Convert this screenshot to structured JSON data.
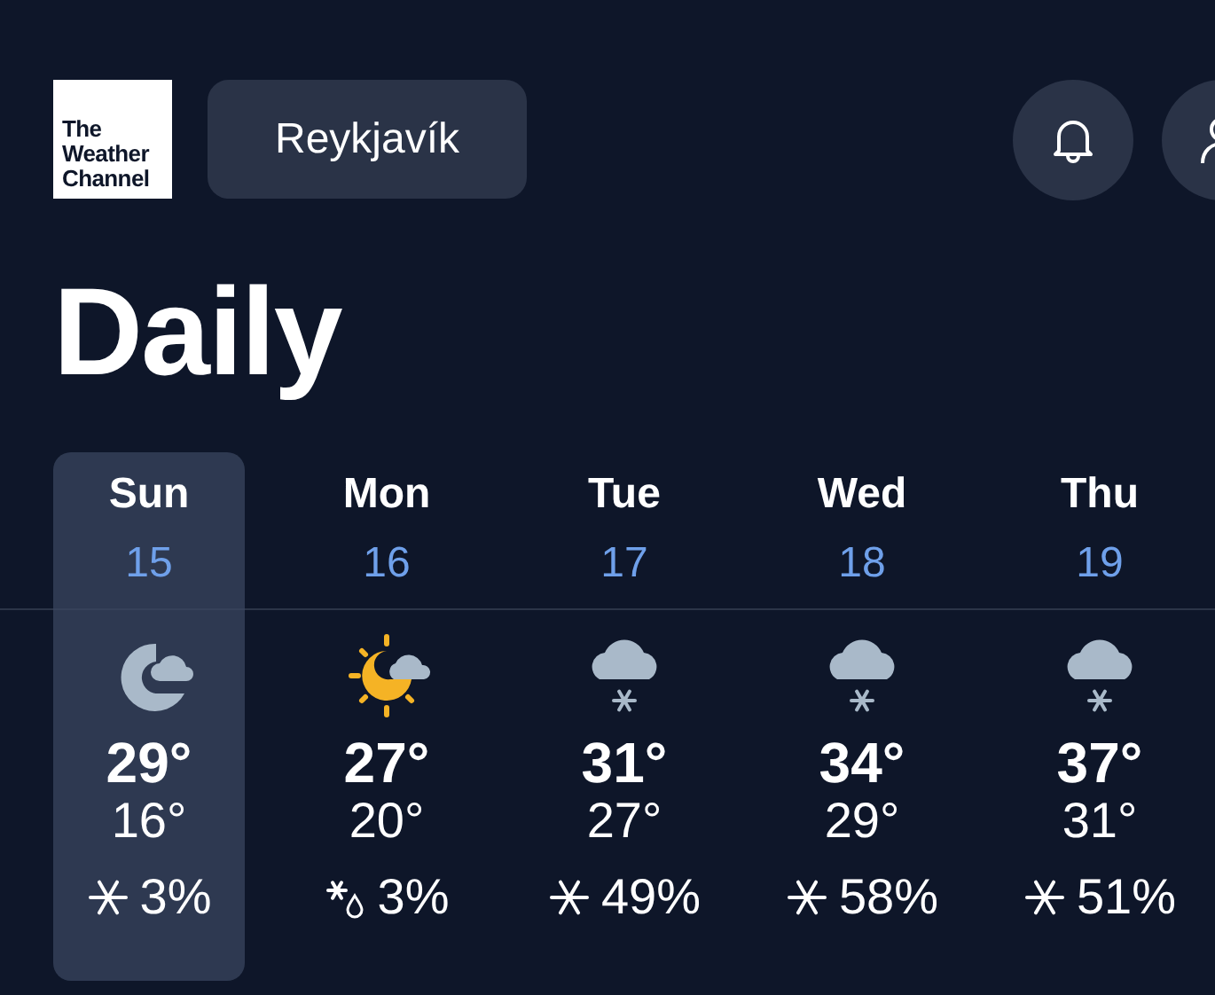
{
  "logo": {
    "lines": [
      "The",
      "Weather",
      "Channel"
    ]
  },
  "location": "Reykjavík",
  "title": "Daily",
  "days": [
    {
      "day": "Sun",
      "date": "15",
      "selected": true,
      "kind": "night-cloudy",
      "high": "29°",
      "low": "16°",
      "precip": {
        "kind": "snow",
        "text": "3%"
      }
    },
    {
      "day": "Mon",
      "date": "16",
      "selected": false,
      "kind": "partly-cloudy",
      "high": "27°",
      "low": "20°",
      "precip": {
        "kind": "mixed",
        "text": "3%"
      }
    },
    {
      "day": "Tue",
      "date": "17",
      "selected": false,
      "kind": "snow",
      "high": "31°",
      "low": "27°",
      "precip": {
        "kind": "snow",
        "text": "49%"
      }
    },
    {
      "day": "Wed",
      "date": "18",
      "selected": false,
      "kind": "snow",
      "high": "34°",
      "low": "29°",
      "precip": {
        "kind": "snow",
        "text": "58%"
      }
    },
    {
      "day": "Thu",
      "date": "19",
      "selected": false,
      "kind": "snow",
      "high": "37°",
      "low": "31°",
      "precip": {
        "kind": "snow",
        "text": "51%"
      }
    }
  ]
}
